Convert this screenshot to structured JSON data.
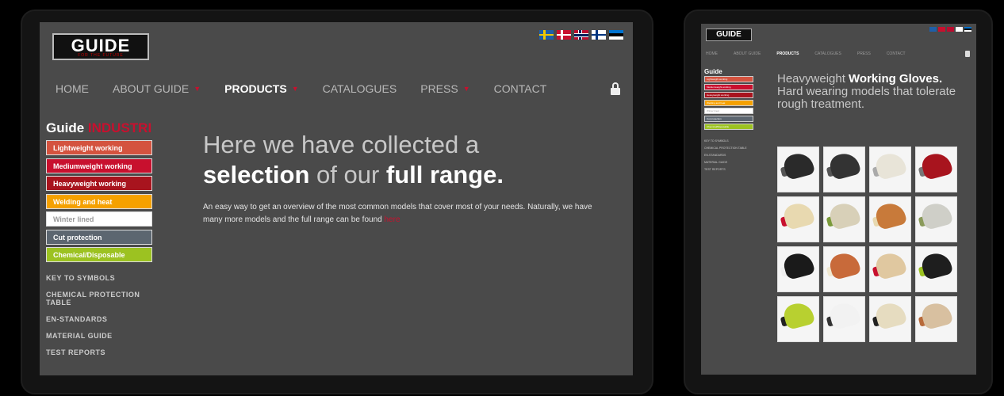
{
  "left": {
    "logo": {
      "name": "GUIDE",
      "tagline": "FOR THE FUTURE"
    },
    "flags": [
      "sweden-flag",
      "denmark-flag",
      "norway-flag",
      "finland-flag",
      "estonia-flag"
    ],
    "nav": [
      {
        "label": "HOME",
        "has_caret": false,
        "active": false
      },
      {
        "label": "ABOUT GUIDE",
        "has_caret": true,
        "active": false
      },
      {
        "label": "PRODUCTS",
        "has_caret": true,
        "active": true
      },
      {
        "label": "CATALOGUES",
        "has_caret": false,
        "active": false
      },
      {
        "label": "PRESS",
        "has_caret": true,
        "active": false
      },
      {
        "label": "CONTACT",
        "has_caret": false,
        "active": false
      }
    ],
    "sidebar": {
      "title": "Guide",
      "title_highlight": "INDUSTRI",
      "categories": [
        {
          "label": "Lightweight working",
          "color": "#d4533f"
        },
        {
          "label": "Mediumweight working",
          "color": "#c8102e"
        },
        {
          "label": "Heavyweight working",
          "color": "#a8141e"
        },
        {
          "label": "Welding and heat",
          "color": "#f5a100"
        },
        {
          "label": "Winter lined",
          "color": "#ffffff"
        },
        {
          "label": "Cut protection",
          "color": "#5c6670"
        },
        {
          "label": "Chemical/Disposable",
          "color": "#9cc221"
        }
      ],
      "links": [
        "KEY TO SYMBOLS",
        "CHEMICAL PROTECTION TABLE",
        "EN-STANDARDS",
        "MATERIAL GUIDE",
        "TEST REPORTS"
      ]
    },
    "hero": {
      "line1": "Here we have collected a",
      "line2_bold1": "selection",
      "line2_mid": " of our ",
      "line2_bold2": "full range.",
      "paragraph": "An easy way to get an overview of the most common models that cover most of your needs. Naturally, we have many more models and the full range can be found ",
      "link": "here"
    }
  },
  "right": {
    "logo": "GUIDE",
    "nav": [
      {
        "label": "HOME",
        "active": false
      },
      {
        "label": "ABOUT GUIDE",
        "active": false
      },
      {
        "label": "PRODUCTS",
        "active": true
      },
      {
        "label": "CATALOGUES",
        "active": false
      },
      {
        "label": "PRESS",
        "active": false
      },
      {
        "label": "CONTACT",
        "active": false
      }
    ],
    "sidebar_title": "Guide",
    "categories": [
      {
        "label": "Lightweight working",
        "color": "#d4533f"
      },
      {
        "label": "Mediumweight working",
        "color": "#c8102e"
      },
      {
        "label": "Heavyweight working",
        "color": "#a8141e"
      },
      {
        "label": "Welding and heat",
        "color": "#f5a100"
      },
      {
        "label": "Winter lined",
        "color": "#ffffff"
      },
      {
        "label": "Cut protection",
        "color": "#5c6670"
      },
      {
        "label": "Chemical/Disposable",
        "color": "#9cc221"
      }
    ],
    "links": [
      "KEY TO SYMBOLS",
      "CHEMICAL PROTECTION TABLE",
      "EN-STANDARDS",
      "MATERIAL GUIDE",
      "TEST REPORTS"
    ],
    "hero": {
      "pre": "Heavyweight ",
      "bold": "Working Gloves.",
      "line2": "Hard wearing models that tolerate rough treatment."
    },
    "gloves": [
      {
        "color": "#2a2a2a",
        "cuff": "#555"
      },
      {
        "color": "#333333",
        "cuff": "#555"
      },
      {
        "color": "#e8e4d8",
        "cuff": "#aaa"
      },
      {
        "color": "#a8141e",
        "cuff": "#777"
      },
      {
        "color": "#e8d9b0",
        "cuff": "#c8102e"
      },
      {
        "color": "#d8d0b8",
        "cuff": "#7a9a3a"
      },
      {
        "color": "#c87a3a",
        "cuff": "#e8d9b0"
      },
      {
        "color": "#cfcfc8",
        "cuff": "#8a9a5a"
      },
      {
        "color": "#1a1a1a",
        "cuff": "#eee"
      },
      {
        "color": "#c86a3a",
        "cuff": "#f0e8d0"
      },
      {
        "color": "#e0c8a0",
        "cuff": "#c8102e"
      },
      {
        "color": "#1e1e1e",
        "cuff": "#9cc221"
      },
      {
        "color": "#b8d030",
        "cuff": "#222"
      },
      {
        "color": "#f2f2f2",
        "cuff": "#333"
      },
      {
        "color": "#e6dcc0",
        "cuff": "#222"
      },
      {
        "color": "#d8c0a0",
        "cuff": "#b86a3a"
      }
    ]
  }
}
